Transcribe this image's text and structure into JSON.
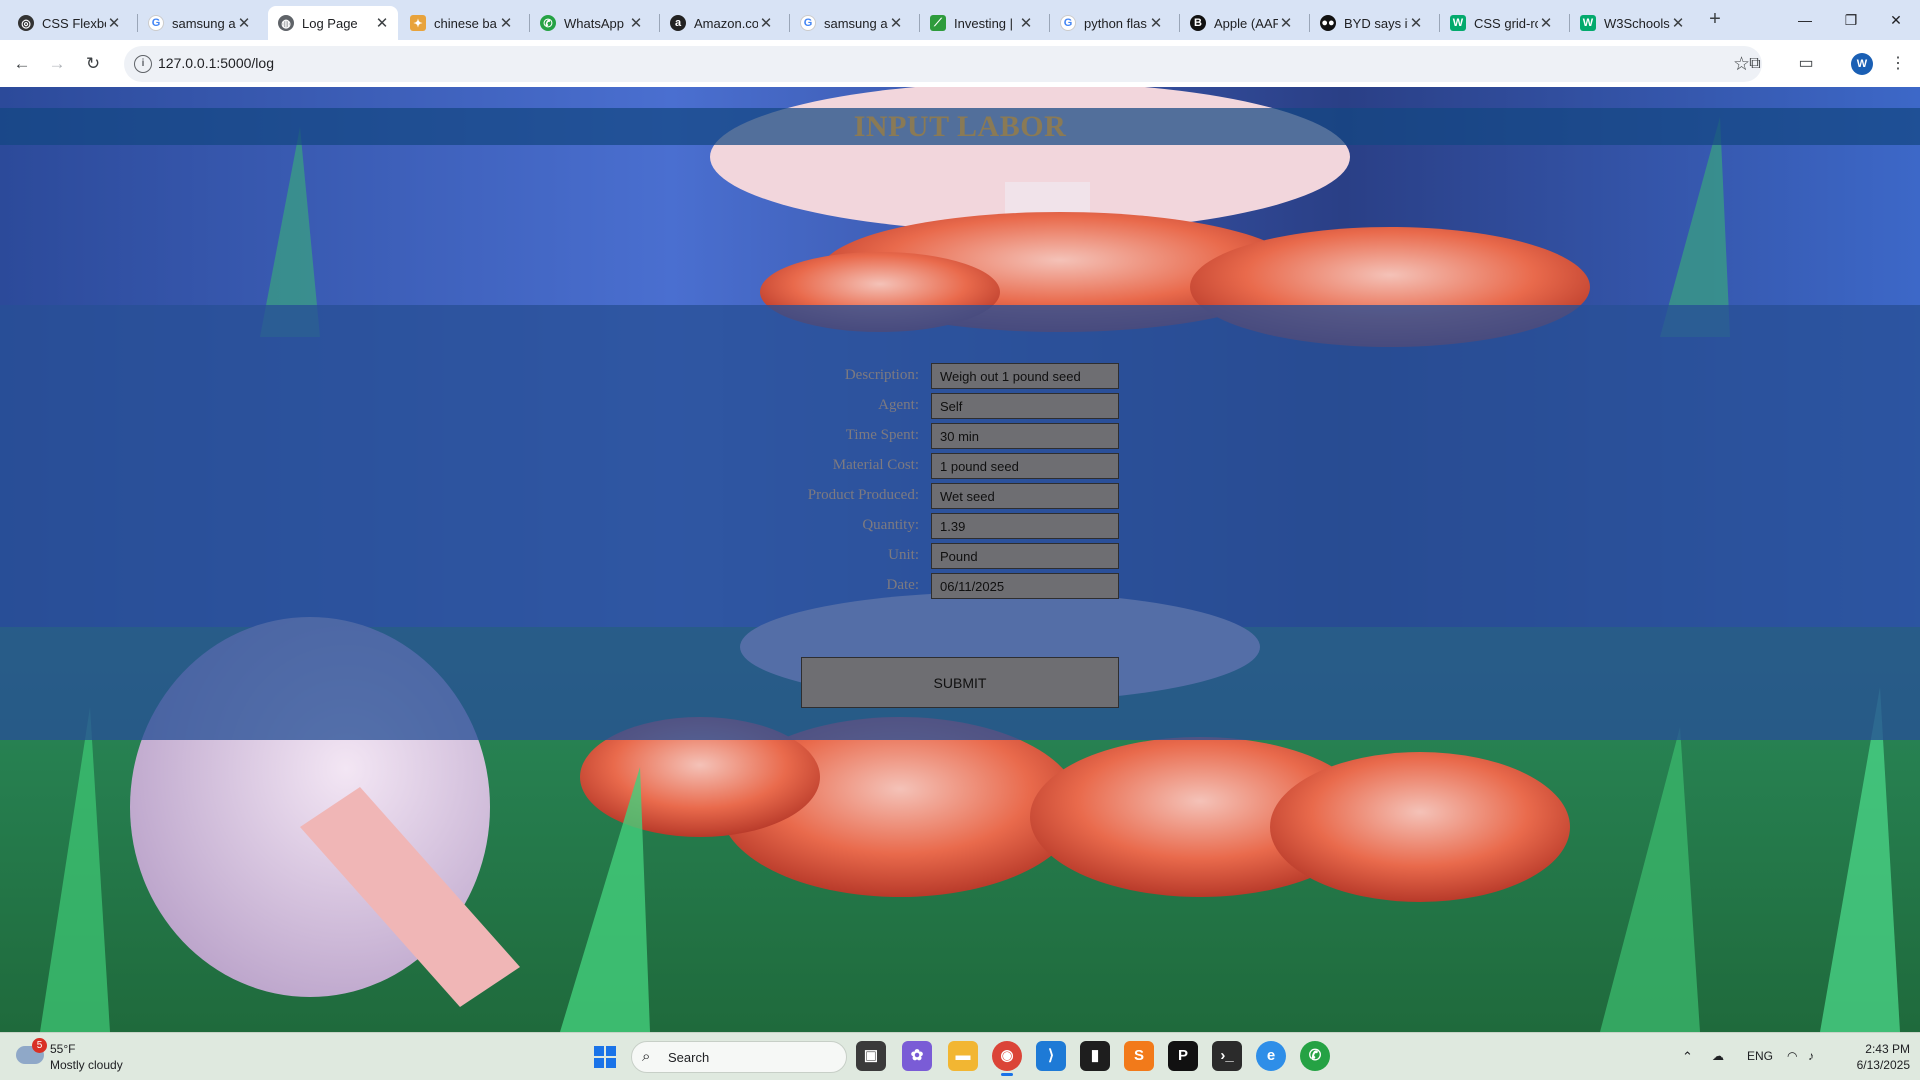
{
  "browser": {
    "tabs": [
      {
        "title": "CSS Flexbox",
        "icon": "css-icon",
        "active": false
      },
      {
        "title": "samsung a",
        "icon": "google-icon",
        "active": false
      },
      {
        "title": "Log Page",
        "icon": "globe-icon",
        "active": true
      },
      {
        "title": "chinese ba",
        "icon": "gemini-icon",
        "active": false
      },
      {
        "title": "WhatsApp",
        "icon": "whatsapp-icon",
        "active": false
      },
      {
        "title": "Amazon.co",
        "icon": "amazon-icon",
        "active": false
      },
      {
        "title": "samsung a",
        "icon": "google-icon",
        "active": false
      },
      {
        "title": "Investing |",
        "icon": "investing-icon",
        "active": false
      },
      {
        "title": "python flas",
        "icon": "google-icon",
        "active": false
      },
      {
        "title": "Apple (AAP",
        "icon": "barrons-icon",
        "active": false
      },
      {
        "title": "BYD says it",
        "icon": "news-icon",
        "active": false
      },
      {
        "title": "CSS grid-ro",
        "icon": "w3schools-icon",
        "active": false
      },
      {
        "title": "W3Schools",
        "icon": "w3schools-icon",
        "active": false
      }
    ],
    "url": "127.0.0.1:5000/log",
    "profile_initial": "W"
  },
  "page": {
    "title": "INPUT LABOR",
    "fields": [
      {
        "label": "Description:",
        "value": "Weigh out 1 pound seed"
      },
      {
        "label": "Agent:",
        "value": "Self"
      },
      {
        "label": "Time Spent:",
        "value": "30 min"
      },
      {
        "label": "Material Cost:",
        "value": "1 pound seed"
      },
      {
        "label": "Product Produced:",
        "value": "Wet seed"
      },
      {
        "label": "Quantity:",
        "value": "1.39"
      },
      {
        "label": "Unit:",
        "value": "Pound"
      },
      {
        "label": "Date:",
        "value": "06/11/2025"
      }
    ],
    "submit_label": "SUBMIT"
  },
  "taskbar": {
    "weather": {
      "temp": "55°F",
      "condition": "Mostly cloudy",
      "badge": "5"
    },
    "search_placeholder": "Search",
    "language": "ENG",
    "time": "2:43 PM",
    "date": "6/13/2025"
  }
}
